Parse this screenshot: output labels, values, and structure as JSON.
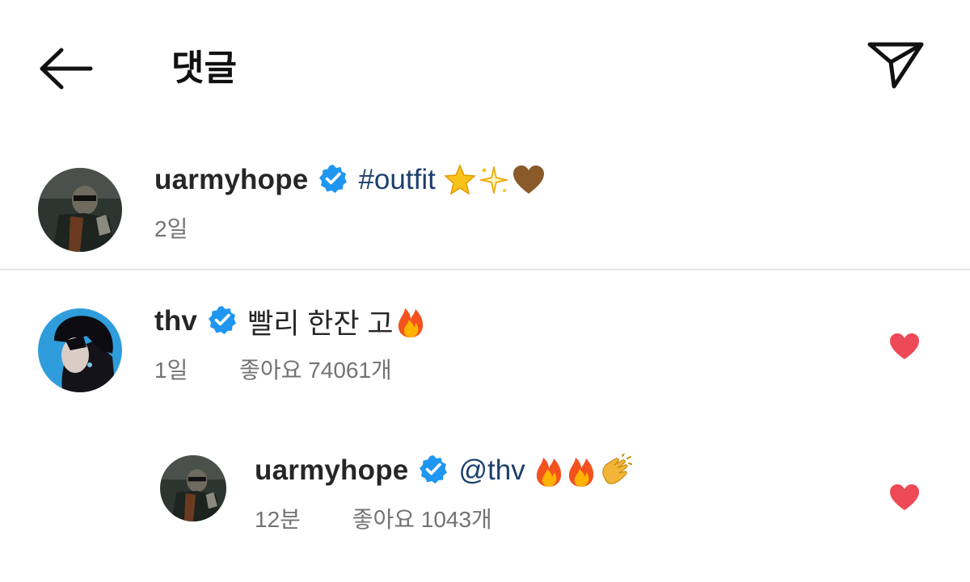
{
  "header": {
    "title": "댓글"
  },
  "caption": {
    "username": "uarmyhope",
    "text": "#outfit",
    "time": "2일"
  },
  "comments": [
    {
      "username": "thv",
      "text": "빨리 한잔 고",
      "time": "1일",
      "likes": "좋아요 74061개"
    },
    {
      "username": "uarmyhope",
      "mention": "@thv",
      "time": "12분",
      "likes": "좋아요 1043개"
    }
  ],
  "colors": {
    "verified": "#1f96f0",
    "heart": "#ed4956",
    "link": "#1c3f6e",
    "meta": "#737373"
  },
  "icons": [
    "back-arrow-icon",
    "send-icon",
    "verified-badge-icon",
    "heart-icon",
    "star-emoji",
    "sparkles-emoji",
    "brown-heart-emoji",
    "fire-emoji",
    "clapping-hands-emoji"
  ]
}
